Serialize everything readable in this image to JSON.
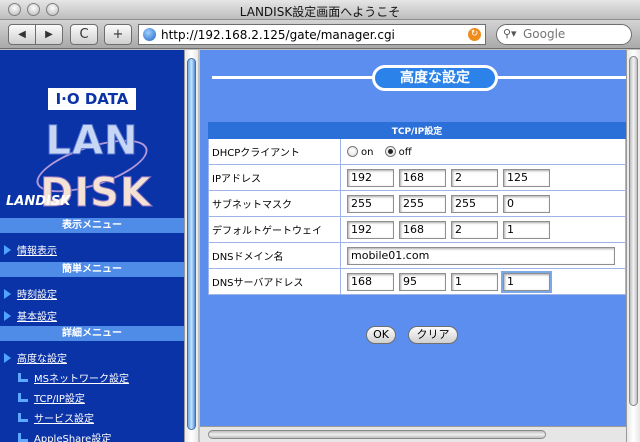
{
  "window": {
    "title": "LANDISK設定画面へようこそ"
  },
  "toolbar": {
    "back_label": "◀",
    "forward_label": "▶",
    "reload_label": "C",
    "add_label": "+",
    "url": "http://192.168.2.125/gate/manager.cgi",
    "search_placeholder": "Google"
  },
  "sidebar": {
    "logo_top": "I·O DATA",
    "logo_lan": "LAN",
    "logo_disk": "DISK",
    "brand": "LANDISK",
    "sections": [
      {
        "header": "表示メニュー",
        "items": [
          "情報表示"
        ]
      },
      {
        "header": "簡単メニュー",
        "items": [
          "時刻設定",
          "基本設定"
        ]
      },
      {
        "header": "詳細メニュー",
        "items": [
          "高度な設定"
        ],
        "subitems": [
          "MSネットワーク設定",
          "TCP/IP設定",
          "サービス設定",
          "AppleShare設定"
        ]
      }
    ]
  },
  "main": {
    "heading": "高度な設定",
    "section_title": "TCP/IP設定",
    "dhcp": {
      "label": "DHCPクライアント",
      "on_label": "on",
      "off_label": "off",
      "selected": "off"
    },
    "ip": {
      "label": "IPアドレス",
      "octets": [
        "192",
        "168",
        "2",
        "125"
      ]
    },
    "subnet": {
      "label": "サブネットマスク",
      "octets": [
        "255",
        "255",
        "255",
        "0"
      ]
    },
    "gateway": {
      "label": "デフォルトゲートウェイ",
      "octets": [
        "192",
        "168",
        "2",
        "1"
      ]
    },
    "dns_domain": {
      "label": "DNSドメイン名",
      "value": "mobile01.com"
    },
    "dns_server": {
      "label": "DNSサーバアドレス",
      "octets": [
        "168",
        "95",
        "1",
        "1"
      ]
    },
    "ok_label": "OK",
    "clear_label": "クリア"
  }
}
